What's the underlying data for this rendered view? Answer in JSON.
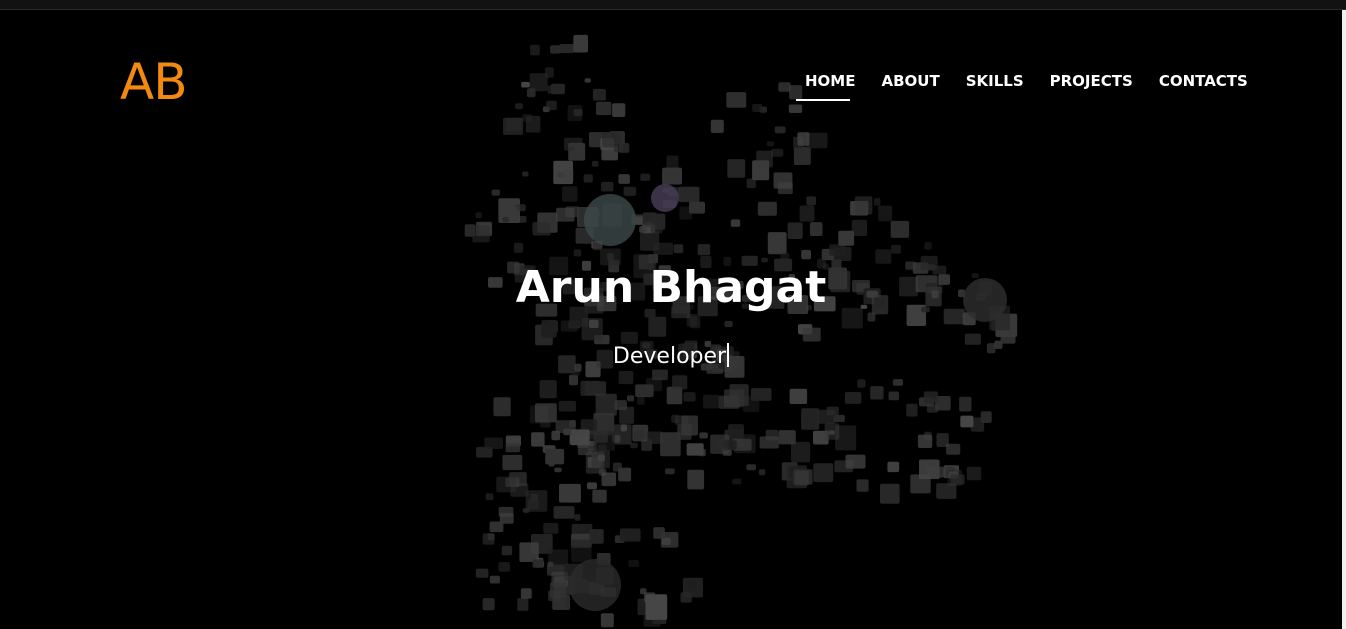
{
  "brand": {
    "logo_text": "AB",
    "accent_color": "#f28a0f"
  },
  "nav": {
    "items": [
      {
        "label": "HOME",
        "active": true
      },
      {
        "label": "ABOUT",
        "active": false
      },
      {
        "label": "SKILLS",
        "active": false
      },
      {
        "label": "PROJECTS",
        "active": false
      },
      {
        "label": "CONTACTS",
        "active": false
      }
    ]
  },
  "hero": {
    "name": "Arun Bhagat",
    "typed_role": "Developer",
    "background_image": "dark mosaic of computer devices forming a running figure"
  }
}
